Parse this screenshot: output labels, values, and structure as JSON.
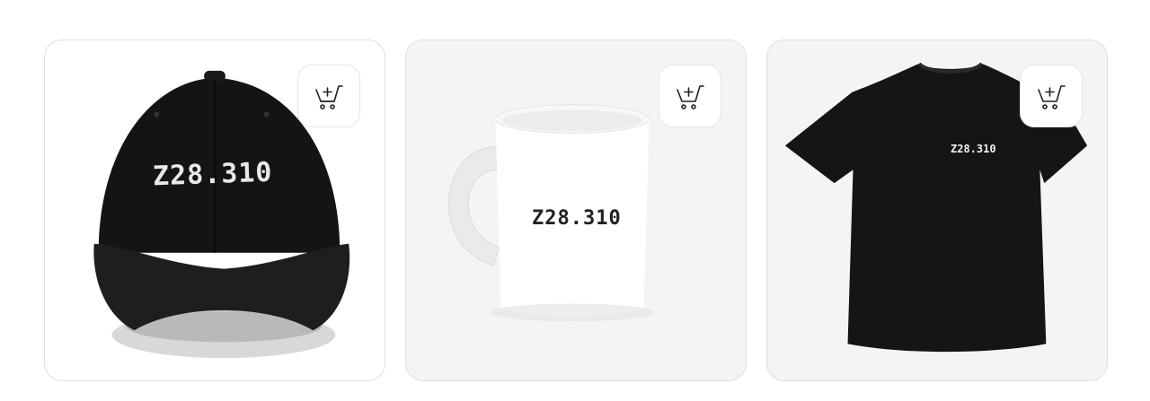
{
  "products": [
    {
      "name": "hat",
      "print_text": "Z28.310",
      "cart_icon": "add-to-cart-icon",
      "background": "#ffffff"
    },
    {
      "name": "mug",
      "print_text": "Z28.310",
      "cart_icon": "add-to-cart-icon",
      "background": "#f3f4f6"
    },
    {
      "name": "t-shirt",
      "print_text": "Z28.310",
      "cart_icon": "add-to-cart-icon",
      "background": "#f3f4f6"
    }
  ]
}
